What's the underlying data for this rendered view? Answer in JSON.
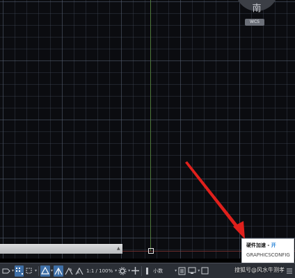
{
  "viewcube": {
    "direction_label": "南",
    "coord_label": "WCS"
  },
  "tooltip": {
    "title": "硬件加速 - ",
    "state": "开",
    "command": "GRAPHICSCONFIG"
  },
  "status_bar": {
    "scale_label": "1:1 / 100%",
    "unit_label": "小数"
  },
  "watermark": {
    "text": "搜狐号@风水牛测孝"
  },
  "colors": {
    "canvas_bg": "#0b0c10",
    "y_axis": "#4f7a3a",
    "x_axis": "#6a2b2b",
    "highlight_active": "#3f6fa6",
    "tooltip_on": "#1f7fd6",
    "annotation_arrow": "#e0201c"
  },
  "icons": [
    "model-space-icon",
    "grid-icon",
    "snap-icon",
    "ortho-icon",
    "polar-icon",
    "osnap-icon",
    "annotation-scale-icon",
    "workspace-gear-icon",
    "plus-icon",
    "units-icon",
    "quick-properties-icon",
    "isolate-icon",
    "hardware-acceleration-icon",
    "fullscreen-icon",
    "customize-icon"
  ]
}
